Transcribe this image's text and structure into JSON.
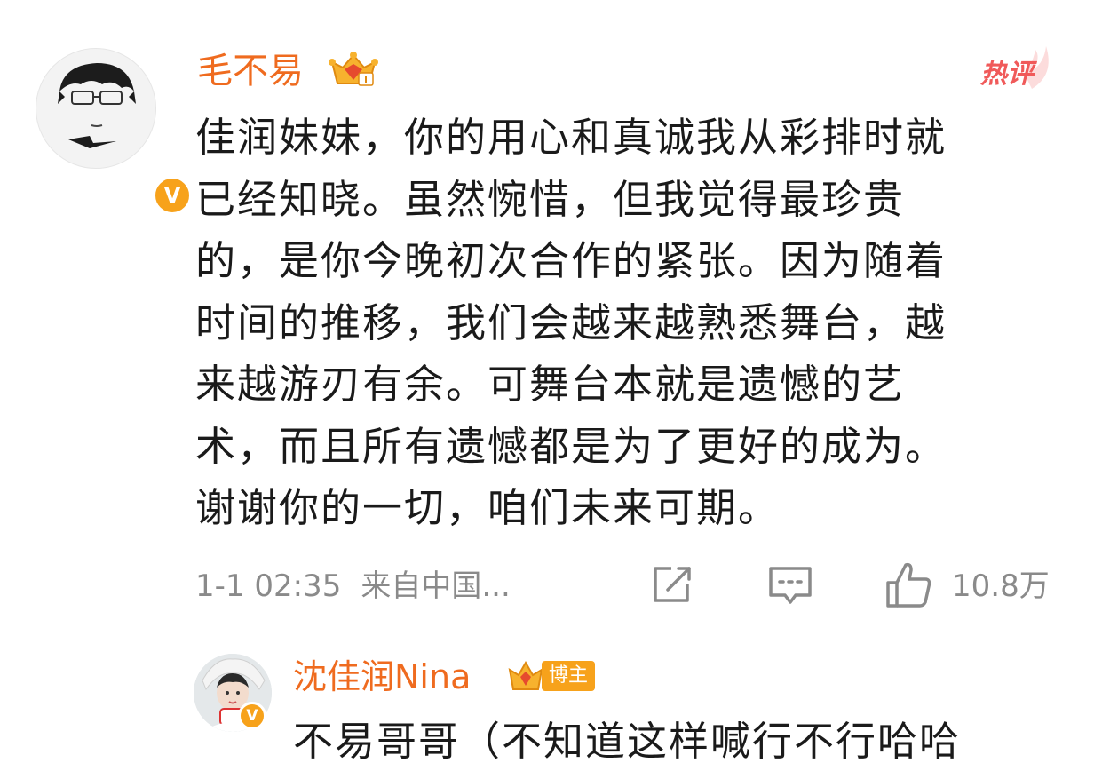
{
  "comment": {
    "username": "毛不易",
    "hot_label": "热评",
    "lines": [
      "佳润妹妹，你的用心和真诚我从彩排时就",
      "已经知晓。虽然惋惜，但我觉得最珍贵",
      "的，是你今晚初次合作的紧张。因为随着",
      "时间的推移，我们会越来越熟悉舞台，越",
      "来越游刃有余。可舞台本就是遗憾的艺",
      "术，而且所有遗憾都是为了更好的成为。",
      "谢谢你的一切，咱们未来可期。"
    ],
    "time": "1-1 02:35",
    "source": "来自中国...",
    "likes": "10.8万",
    "verified_badge": "V"
  },
  "reply": {
    "username": "沈佳润Nina",
    "badge_label": "博主",
    "text": "不易哥哥（不知道这样喊行不行哈哈",
    "verified_badge": "V"
  },
  "colors": {
    "username": "#ef6b1f",
    "hot": "#f05a5a",
    "meta": "#8a8a8a",
    "badge": "#f7a21b"
  },
  "icons": [
    "crown-badge-icon",
    "hot-comment-icon",
    "share-icon",
    "comment-icon",
    "like-icon",
    "verified-icon"
  ]
}
